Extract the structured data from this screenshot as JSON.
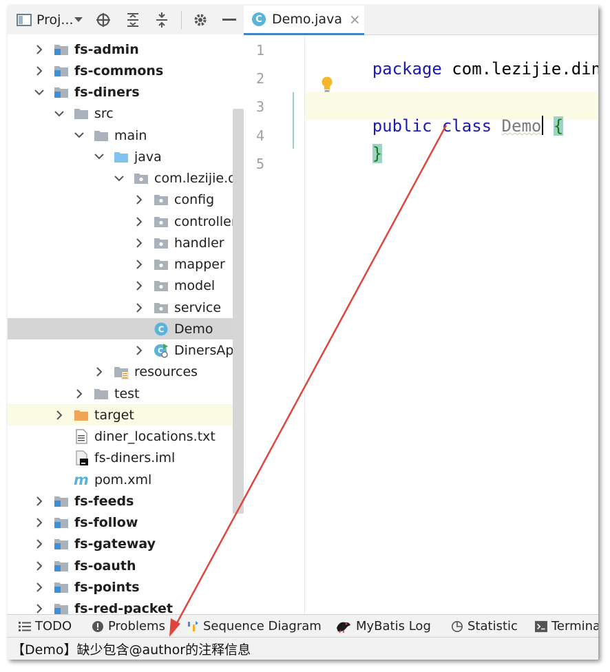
{
  "project_toolbar": {
    "title": "Proj...",
    "icons": [
      "project-icon",
      "dropdown-icon",
      "locate-icon",
      "expand-all-icon",
      "collapse-all-icon",
      "gear-icon",
      "minimize-icon"
    ]
  },
  "tree": [
    {
      "label": "fs-admin",
      "indent": 0,
      "expand": "collapsed",
      "icon": "module-folder-icon",
      "bold": true
    },
    {
      "label": "fs-commons",
      "indent": 0,
      "expand": "collapsed",
      "icon": "module-folder-icon",
      "bold": true
    },
    {
      "label": "fs-diners",
      "indent": 0,
      "expand": "expanded",
      "icon": "module-folder-icon",
      "bold": true
    },
    {
      "label": "src",
      "indent": 1,
      "expand": "expanded",
      "icon": "folder-icon"
    },
    {
      "label": "main",
      "indent": 2,
      "expand": "expanded",
      "icon": "folder-icon"
    },
    {
      "label": "java",
      "indent": 3,
      "expand": "expanded",
      "icon": "source-folder-icon"
    },
    {
      "label": "com.lezijie.diners",
      "indent": 4,
      "expand": "expanded",
      "icon": "package-icon"
    },
    {
      "label": "config",
      "indent": 5,
      "expand": "collapsed",
      "icon": "package-icon"
    },
    {
      "label": "controller",
      "indent": 5,
      "expand": "collapsed",
      "icon": "package-icon"
    },
    {
      "label": "handler",
      "indent": 5,
      "expand": "collapsed",
      "icon": "package-icon"
    },
    {
      "label": "mapper",
      "indent": 5,
      "expand": "collapsed",
      "icon": "package-icon"
    },
    {
      "label": "model",
      "indent": 5,
      "expand": "collapsed",
      "icon": "package-icon"
    },
    {
      "label": "service",
      "indent": 5,
      "expand": "collapsed",
      "icon": "package-icon"
    },
    {
      "label": "Demo",
      "indent": 5,
      "expand": "none",
      "icon": "class-icon",
      "selected": true
    },
    {
      "label": "DinersApplication",
      "indent": 5,
      "expand": "collapsed",
      "icon": "spring-class-icon"
    },
    {
      "label": "resources",
      "indent": 3,
      "expand": "collapsed",
      "icon": "resources-folder-icon"
    },
    {
      "label": "test",
      "indent": 2,
      "expand": "collapsed",
      "icon": "folder-icon"
    },
    {
      "label": "target",
      "indent": 1,
      "expand": "collapsed",
      "icon": "excluded-folder-icon",
      "highlight": true
    },
    {
      "label": "diner_locations.txt",
      "indent": 1,
      "expand": "none",
      "icon": "text-file-icon"
    },
    {
      "label": "fs-diners.iml",
      "indent": 1,
      "expand": "none",
      "icon": "iml-file-icon"
    },
    {
      "label": "pom.xml",
      "indent": 1,
      "expand": "none",
      "icon": "maven-icon"
    },
    {
      "label": "fs-feeds",
      "indent": 0,
      "expand": "collapsed",
      "icon": "module-folder-icon",
      "bold": true
    },
    {
      "label": "fs-follow",
      "indent": 0,
      "expand": "collapsed",
      "icon": "module-folder-icon",
      "bold": true
    },
    {
      "label": "fs-gateway",
      "indent": 0,
      "expand": "collapsed",
      "icon": "module-folder-icon",
      "bold": true
    },
    {
      "label": "fs-oauth",
      "indent": 0,
      "expand": "collapsed",
      "icon": "module-folder-icon",
      "bold": true
    },
    {
      "label": "fs-points",
      "indent": 0,
      "expand": "collapsed",
      "icon": "module-folder-icon",
      "bold": true
    },
    {
      "label": "fs-red-packet",
      "indent": 0,
      "expand": "collapsed",
      "icon": "module-folder-icon",
      "bold": true
    }
  ],
  "editor": {
    "tab": {
      "icon_letter": "C",
      "label": "Demo.java",
      "close": "×"
    },
    "line_numbers": [
      "1",
      "2",
      "3",
      "4",
      "5"
    ],
    "code": {
      "l1_kw": "package",
      "l1_rest": " com.lezijie.diners;",
      "l3_kw": "public class",
      "l3_class": "Demo",
      "l3_brace": "{",
      "l4_brace": "}"
    }
  },
  "bottom_tools": [
    {
      "label": "TODO",
      "icon": "todo-icon"
    },
    {
      "label": "Problems",
      "icon": "problems-icon"
    },
    {
      "label": "Sequence Diagram",
      "icon": "sequence-diagram-icon"
    },
    {
      "label": "MyBatis Log",
      "icon": "mybatis-bird-icon"
    },
    {
      "label": "Statistic",
      "icon": "statistic-icon"
    },
    {
      "label": "Terminal",
      "icon": "terminal-icon"
    }
  ],
  "status": {
    "message": "【Demo】缺少包含@author的注释信息"
  },
  "colors": {
    "accent": "#4083c9",
    "selected_row": "#d5d5d5",
    "caret_line": "#fcfbe6",
    "arrow": "#e0443c",
    "keyword": "#1a1ab0"
  }
}
